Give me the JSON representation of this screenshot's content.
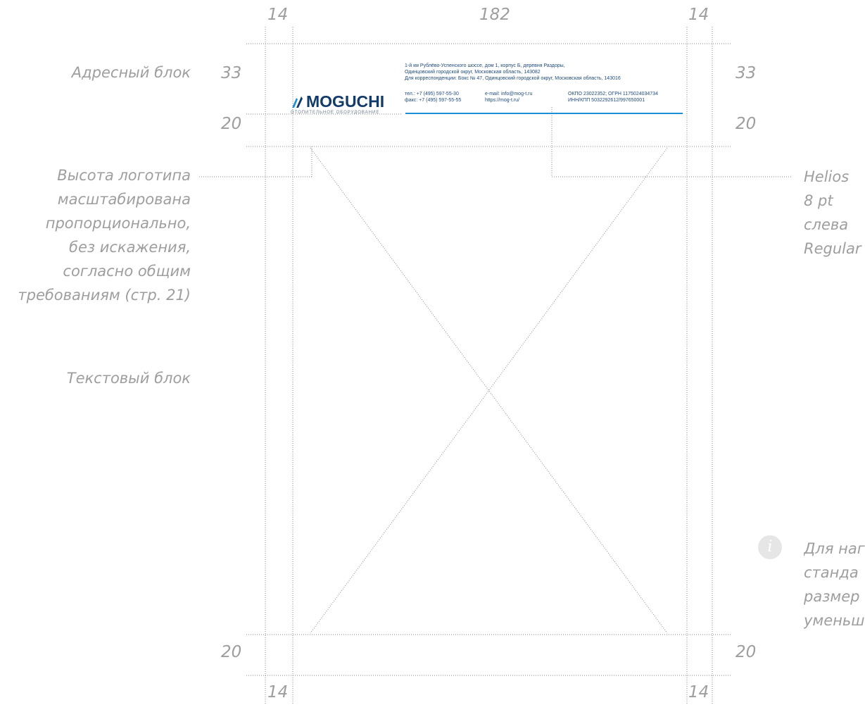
{
  "dimensions": {
    "top_left": "14",
    "top_center": "182",
    "top_right": "14",
    "left_33": "33",
    "left_20_top": "20",
    "right_33": "33",
    "right_20_top": "20",
    "left_20_bottom": "20",
    "right_20_bottom": "20",
    "bottom_left": "14",
    "bottom_right": "14"
  },
  "labels": {
    "address_block": "Адресный блок",
    "text_block": "Текстовый блок",
    "logo_note": [
      "Высота логотипа",
      "масштабирована",
      "пропорционально,",
      "без искажения,",
      "согласно общим",
      "требованиям (стр. 21)"
    ],
    "font_spec": [
      "Helios",
      "8 pt",
      "слева",
      "Regular"
    ],
    "info_note": [
      "Для наг",
      "станда",
      "размер",
      "уменьш"
    ]
  },
  "header": {
    "logo_text": "MOGUCHI",
    "logo_tagline": "ОТОПИТЕЛЬНОЕ ОБОРУДОВАНИЕ",
    "address_lines": [
      "1-й км Рублёво-Успенского шоссе, дом 1, корпус Б, деревня Раздоры,",
      "Одинцовский городской округ, Московская область, 143082",
      "Для корреспонденции: Бокс № 47, Одинцовский городской округ, Московская область, 143016"
    ],
    "phone": "тел.: +7 (495) 597-55-30",
    "fax": "факс: +7 (495) 597-55-55",
    "email": "e-mail: info@mog-t.ru",
    "site": "https://mog-t.ru/",
    "okpo": "ОКПО 23022352; ОГРН 1175024034734",
    "inn": "ИНН/КПП 5032292612/997650001"
  },
  "colors": {
    "guide": "#9a9a9a",
    "brand_dark": "#123a6b",
    "brand_accent": "#1d8fd6"
  },
  "icons": {
    "info": "info-icon"
  }
}
